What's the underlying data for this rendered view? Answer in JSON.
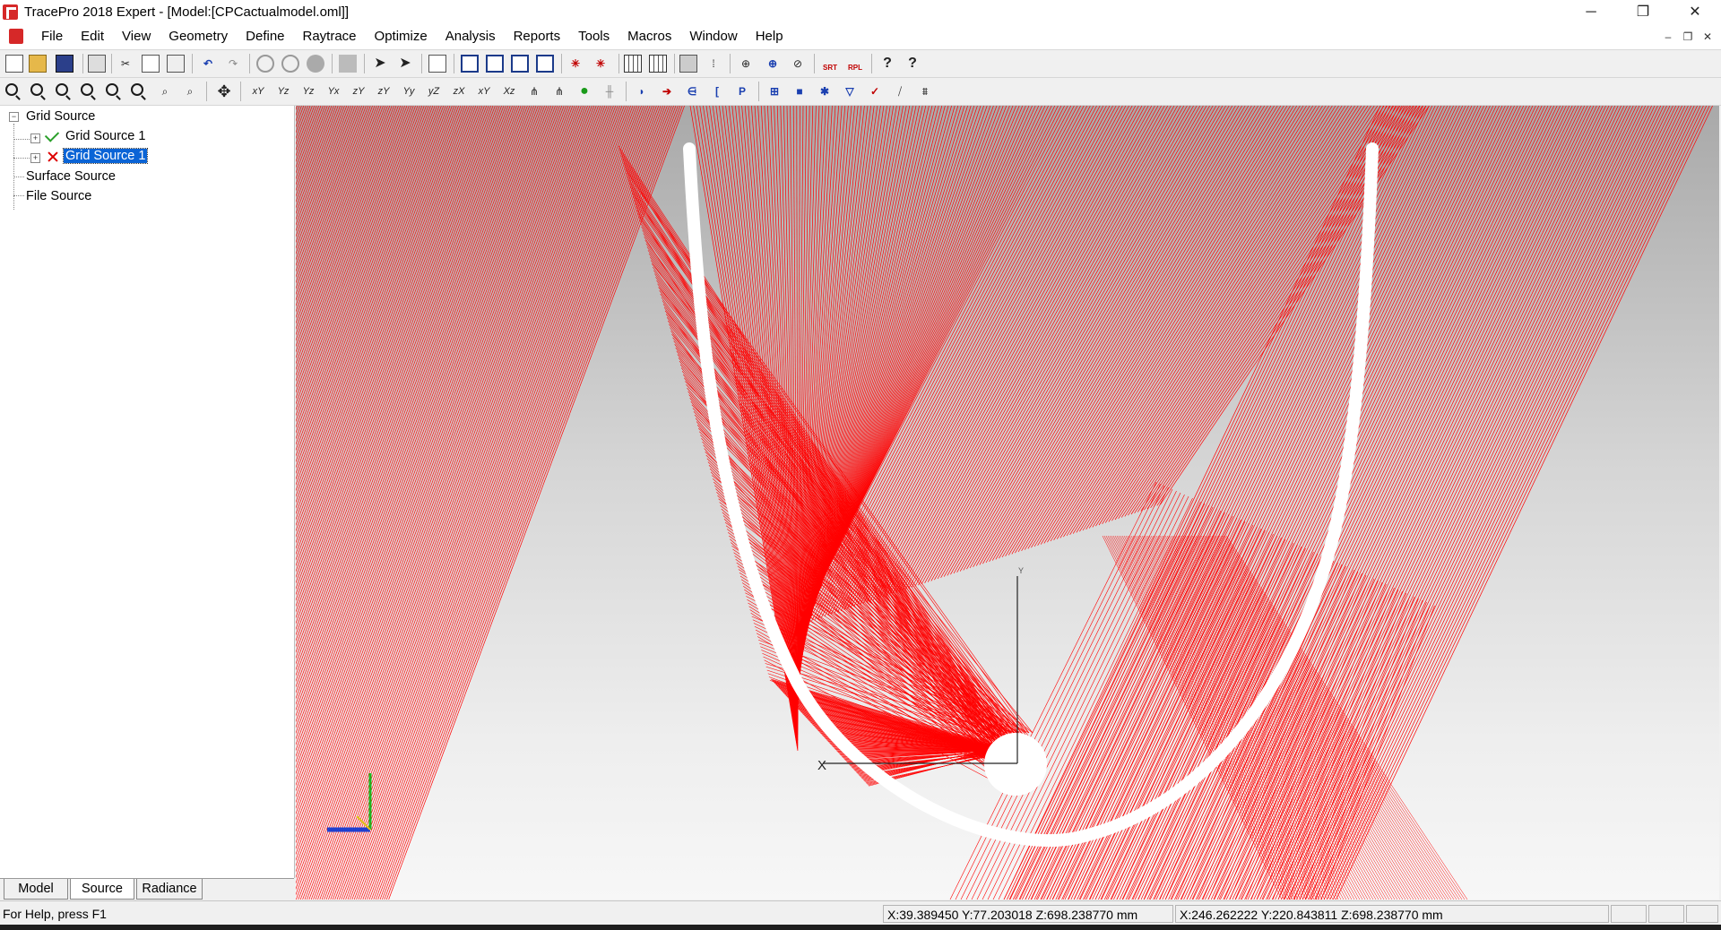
{
  "window": {
    "title": "TracePro 2018 Expert - [Model:[CPCactualmodel.oml]]",
    "minimize": "─",
    "restore": "❐",
    "close": "✕"
  },
  "menu": {
    "items": [
      "File",
      "Edit",
      "View",
      "Geometry",
      "Define",
      "Raytrace",
      "Optimize",
      "Analysis",
      "Reports",
      "Tools",
      "Macros",
      "Window",
      "Help"
    ],
    "mdi_minimize": "–",
    "mdi_restore": "❐",
    "mdi_close": "✕"
  },
  "toolbar": {
    "icons1": [
      "new-file",
      "open-folder",
      "save",
      "print",
      "cut",
      "copy",
      "paste",
      "undo",
      "redo",
      "boolean-union",
      "boolean-subtract",
      "boolean-intersect",
      "move-object",
      "select-arrow",
      "select-surface",
      "properties",
      "single-view",
      "cascade",
      "tile-horizontal",
      "tile-vertical",
      "trace-rays",
      "trace-rays-rev",
      "grid",
      "ray-table",
      "irradiance-map",
      "candela-plot",
      "source-display",
      "ray-sort",
      "polar-plot",
      "ray-sort-srt",
      "ray-sort-rpl",
      "help",
      "context-help"
    ],
    "labels1": {
      "cut": "✂",
      "undo": "↶",
      "redo": "↷",
      "srt": "SRT",
      "rpl": "RPL",
      "help": "?",
      "context_help": "?"
    },
    "labels2": [
      "xY",
      "Yz",
      "Yz",
      "Yx",
      "zY",
      "zY",
      "Yy",
      "yZ",
      "zX",
      "xY",
      "Xz"
    ],
    "misc2": {
      "pan": "✥",
      "p_label": "P"
    }
  },
  "tree": {
    "root": "Grid Source",
    "children": [
      {
        "label": "Grid Source 1",
        "status": "check-icon",
        "expander": "+"
      },
      {
        "label": "Grid Source 1",
        "status": "cross-icon",
        "expander": "+",
        "selected": true
      }
    ],
    "siblings": [
      "Surface Source",
      "File Source"
    ],
    "root_expander": "−"
  },
  "tabs": [
    "Model",
    "Source",
    "Radiance"
  ],
  "active_tab": "Source",
  "viewport": {
    "axis_label_x": "X",
    "axis_label_y": "Y",
    "ray_color": "#ff0000",
    "reflector_color": "#ffffff"
  },
  "status": {
    "help": "For Help, press F1",
    "coord1": "X:39.389450 Y:77.203018 Z:698.238770 mm",
    "coord2": "X:246.262222 Y:220.843811 Z:698.238770 mm"
  }
}
